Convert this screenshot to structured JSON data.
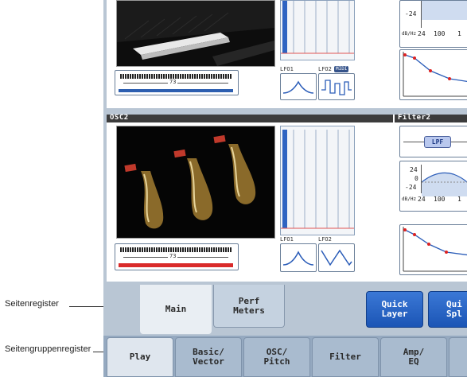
{
  "callouts": {
    "page_tabs_label": "Seitenregister",
    "page_group_tabs_label": "Seitengruppenregister"
  },
  "osc1": {
    "key_value": "73",
    "lfo1_label": "LFO1",
    "lfo2_label": "LFO2",
    "lfo2_badge": "MIDI"
  },
  "filter1": {
    "eq_tick_low": "-24",
    "eq_unit": "dB/Hz",
    "eq_freq_1": "24",
    "eq_freq_2": "100",
    "eq_freq_3": "1"
  },
  "osc2": {
    "header": "OSC2",
    "key_value": "73",
    "lfo1_label": "LFO1",
    "lfo2_label": "LFO2"
  },
  "filter2": {
    "header": "Filter2",
    "filter_type": "LPF",
    "eq_tick_high": "24",
    "eq_tick_mid": "0",
    "eq_tick_low": "-24",
    "eq_unit": "dB/Hz",
    "eq_freq_1": "24",
    "eq_freq_2": "100",
    "eq_freq_3": "1"
  },
  "page_tabs": {
    "main": "Main",
    "perf_meters_line1": "Perf",
    "perf_meters_line2": "Meters",
    "quick_layer_line1": "Quick",
    "quick_layer_line2": "Layer",
    "quick_split_line1": "Qui",
    "quick_split_line2": "Spl"
  },
  "group_tabs": {
    "play": "Play",
    "basic_line1": "Basic/",
    "basic_line2": "Vector",
    "osc_line1": "OSC/",
    "osc_line2": "Pitch",
    "filter": "Filter",
    "amp_line1": "Amp/",
    "amp_line2": "EQ"
  },
  "colors": {
    "osc1_key_bar": "#2d5fb0",
    "osc2_key_bar": "#d92a2a",
    "accent_blue": "#2b66c7"
  }
}
